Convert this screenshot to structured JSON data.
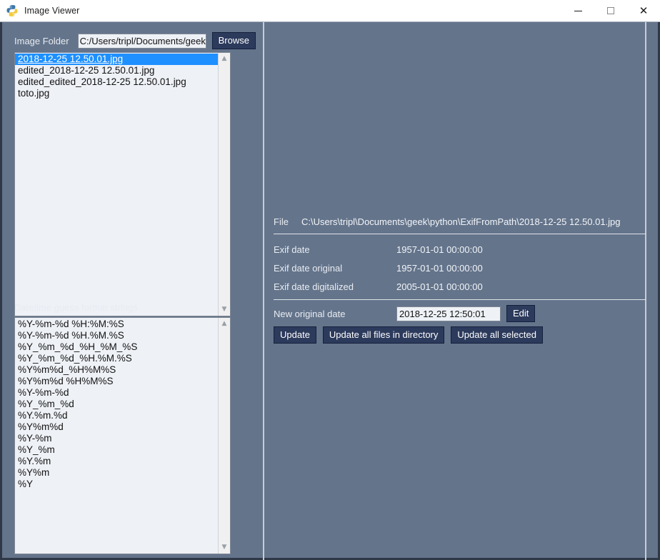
{
  "window": {
    "title": "Image Viewer",
    "icon": "python-logo-icon",
    "controls": {
      "minimize": "–",
      "maximize": "□",
      "close": "✕"
    }
  },
  "left_panel": {
    "folder_label": "Image Folder",
    "folder_value": "C:/Users/tripl/Documents/geek",
    "folder_placeholder": "",
    "browse_label": "Browse",
    "files": [
      "2018-12-25 12.50.01.jpg",
      "edited_2018-12-25 12.50.01.jpg",
      "edited_edited_2018-12-25 12.50.01.jpg",
      "toto.jpg"
    ],
    "selected_file_index": 0,
    "formats_label": "Datetime guess format strings",
    "formats": [
      "%Y-%m-%d %H:%M:%S",
      "%Y-%m-%d %H.%M.%S",
      "%Y_%m_%d_%H_%M_%S",
      "%Y_%m_%d_%H.%M.%S",
      "%Y%m%d_%H%M%S",
      "%Y%m%d %H%M%S",
      "%Y-%m-%d",
      "%Y_%m_%d",
      "%Y.%m.%d",
      "%Y%m%d",
      "%Y-%m",
      "%Y_%m",
      "%Y.%m",
      "%Y%m",
      "%Y"
    ],
    "scrollbar": {
      "up": "▲",
      "down": "▼"
    }
  },
  "right_panel": {
    "file_key": "File",
    "file_value": "C:\\Users\\tripl\\Documents\\geek\\python\\ExifFromPath\\2018-12-25 12.50.01.jpg",
    "exif_rows": [
      {
        "key": "Exif date",
        "value": "1957-01-01 00:00:00"
      },
      {
        "key": "Exif date original",
        "value": "1957-01-01 00:00:00"
      },
      {
        "key": "Exif date digitalized",
        "value": "2005-01-01 00:00:00"
      }
    ],
    "new_date_label": "New original date",
    "new_date_value": "2018-12-25 12:50:01",
    "edit_label": "Edit",
    "update_label": "Update",
    "update_all_dir_label": "Update all files in directory",
    "update_all_selected_label": "Update all selected"
  },
  "colors": {
    "app_background": "#64748b",
    "button": "#2c3a5c",
    "input_background": "#eef1f6",
    "selection": "#1e90ff",
    "label_text": "#e8ecf2",
    "titlebar": "#ffffff"
  }
}
